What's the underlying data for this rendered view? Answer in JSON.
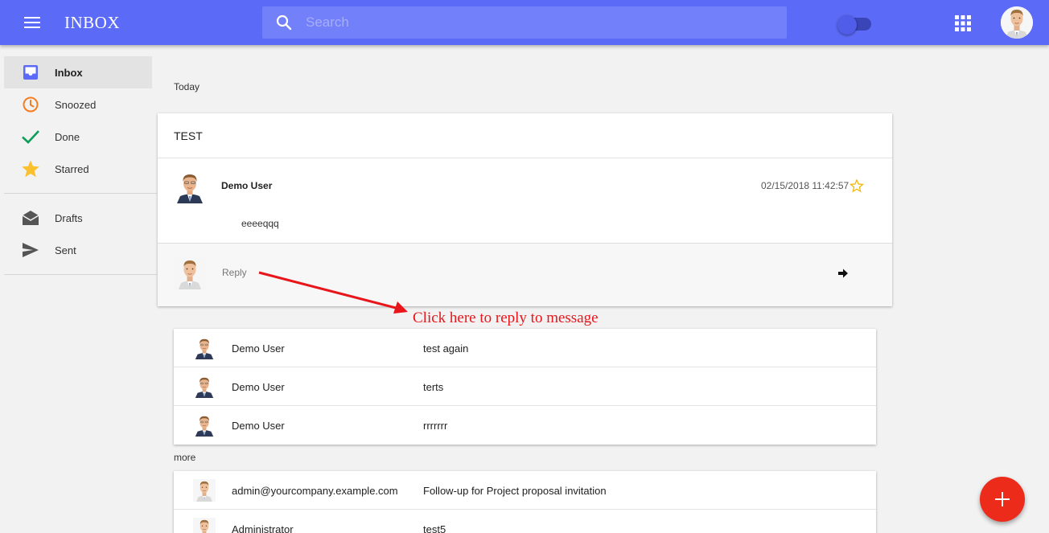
{
  "header": {
    "menu_icon": "hamburger-menu-icon",
    "title": "INBOX",
    "search_placeholder": "Search",
    "search_value": "",
    "apps_icon": "apps-grid-icon"
  },
  "sidebar": {
    "items": [
      {
        "label": "Inbox",
        "icon": "inbox-icon",
        "color": "#5c6bf7",
        "active": true
      },
      {
        "label": "Snoozed",
        "icon": "clock-icon",
        "color": "#f57c1f"
      },
      {
        "label": "Done",
        "icon": "check-icon",
        "color": "#0f9d58"
      },
      {
        "label": "Starred",
        "icon": "star-icon",
        "color": "#fbc02d"
      },
      {
        "label": "Drafts",
        "icon": "drafts-icon",
        "color": "#555555"
      },
      {
        "label": "Sent",
        "icon": "send-icon",
        "color": "#555555"
      }
    ]
  },
  "main": {
    "today_label": "Today",
    "thread": {
      "title": "TEST",
      "message": {
        "sender": "Demo User",
        "date": "02/15/2018 11:42:57",
        "body": "eeeeqqq"
      },
      "reply_placeholder": "Reply"
    },
    "annotation": "Click here to reply to message",
    "today_list": [
      {
        "sender": "Demo User",
        "subject": "test again"
      },
      {
        "sender": "Demo User",
        "subject": "terts"
      },
      {
        "sender": "Demo User",
        "subject": "rrrrrrr"
      }
    ],
    "more_label": "more",
    "more_list": [
      {
        "sender": "admin@yourcompany.example.com",
        "subject": "Follow-up for Project proposal invitation"
      },
      {
        "sender": "Administrator",
        "subject": "test5"
      }
    ]
  },
  "fab": {
    "icon": "plus-icon"
  },
  "colors": {
    "primary": "#5c6bf7",
    "fab": "#ec2b1b",
    "annotation": "#e8161a"
  }
}
